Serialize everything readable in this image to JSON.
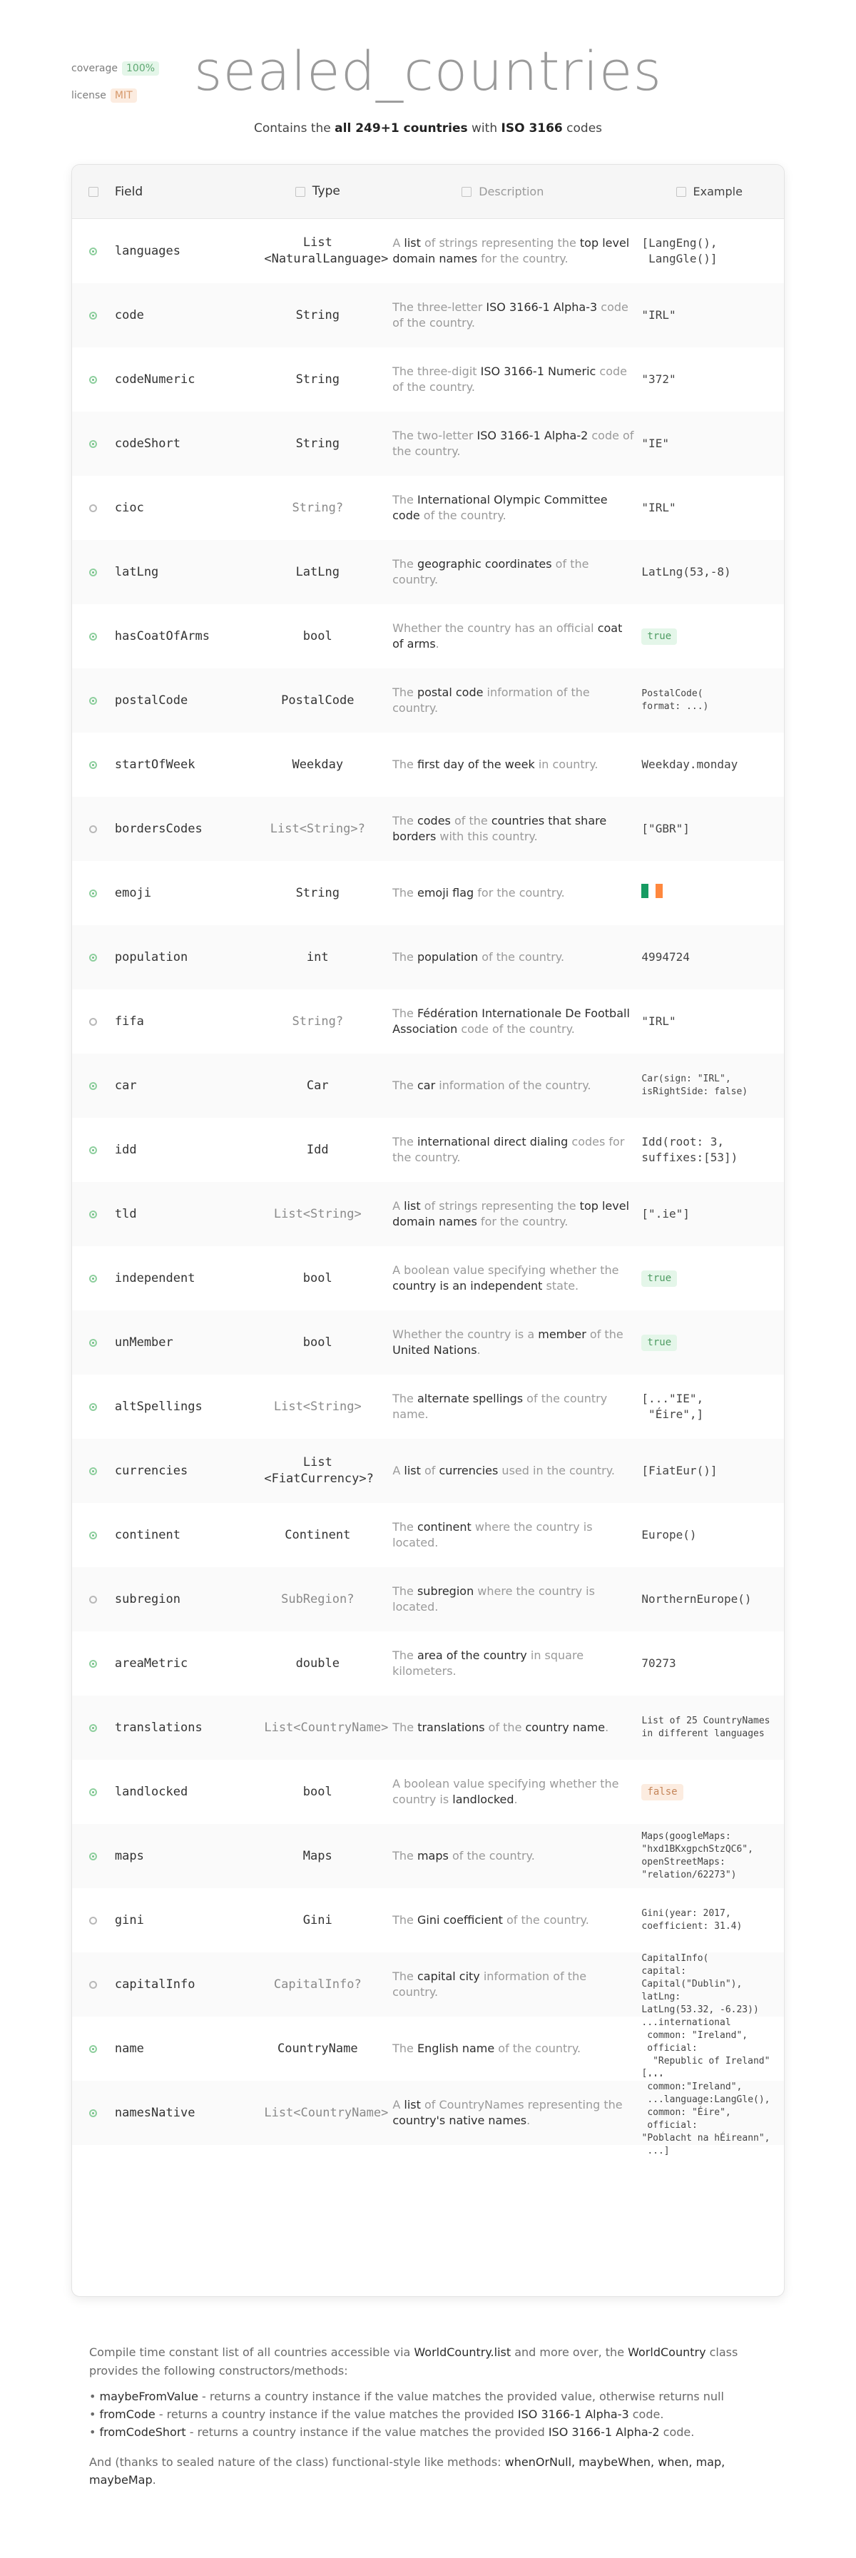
{
  "badges": [
    {
      "label": "coverage",
      "value": "100%"
    },
    {
      "label": "license",
      "value": "MIT"
    }
  ],
  "title": "sealed_countries",
  "subtitle": {
    "pre": "Contains the ",
    "bold1": "all 249+1 countries",
    "mid": " with ",
    "bold2": "ISO 3166",
    "post": " codes"
  },
  "table": {
    "headers": {
      "field": "Field",
      "type": "Type",
      "description": "Description",
      "example": "Example"
    },
    "rows": [
      {
        "field": "languages",
        "required": true,
        "type": [
          "List",
          "<NaturalLanguage>"
        ],
        "type_muted": false,
        "desc": [
          [
            "A ",
            false
          ],
          [
            "list",
            true
          ],
          [
            " of strings representing the ",
            false
          ],
          [
            "top level domain names",
            true
          ],
          [
            " for the country.",
            false
          ]
        ],
        "example": [
          "[LangEng(),",
          " LangGle()]"
        ],
        "ex_style": "mono"
      },
      {
        "field": "code",
        "required": true,
        "type": [
          "String"
        ],
        "type_muted": false,
        "desc": [
          [
            "The three-letter ",
            false
          ],
          [
            "ISO 3166-1 Alpha-3",
            true
          ],
          [
            " code of the country.",
            false
          ]
        ],
        "example": [
          "\"IRL\""
        ],
        "ex_style": "mono"
      },
      {
        "field": "codeNumeric",
        "required": true,
        "type": [
          "String"
        ],
        "type_muted": false,
        "desc": [
          [
            "The three-digit ",
            false
          ],
          [
            "ISO 3166-1 Numeric",
            true
          ],
          [
            " code of the country.",
            false
          ]
        ],
        "example": [
          "\"372\""
        ],
        "ex_style": "mono"
      },
      {
        "field": "codeShort",
        "required": true,
        "type": [
          "String"
        ],
        "type_muted": false,
        "desc": [
          [
            "The two-letter ",
            false
          ],
          [
            "ISO 3166-1 Alpha-2",
            true
          ],
          [
            " code of the country.",
            false
          ]
        ],
        "example": [
          "\"IE\""
        ],
        "ex_style": "mono"
      },
      {
        "field": "cioc",
        "required": false,
        "type": [
          "String?"
        ],
        "type_muted": true,
        "desc": [
          [
            "The ",
            false
          ],
          [
            "International Olympic Committee code",
            true
          ],
          [
            " of the country.",
            false
          ]
        ],
        "example": [
          "\"IRL\""
        ],
        "ex_style": "mono"
      },
      {
        "field": "latLng",
        "required": true,
        "type": [
          "LatLng"
        ],
        "type_muted": false,
        "desc": [
          [
            "The ",
            false
          ],
          [
            "geographic coordinates",
            true
          ],
          [
            " of the country.",
            false
          ]
        ],
        "example": [
          "LatLng(53,-8)"
        ],
        "ex_style": "mono"
      },
      {
        "field": "hasCoatOfArms",
        "required": true,
        "type": [
          "bool"
        ],
        "type_muted": false,
        "desc": [
          [
            "Whether the country has an official ",
            false
          ],
          [
            "coat of arms",
            true
          ],
          [
            ".",
            false
          ]
        ],
        "example": [
          "true"
        ],
        "ex_style": "pill-true"
      },
      {
        "field": "postalCode",
        "required": true,
        "type": [
          "PostalCode"
        ],
        "type_muted": false,
        "desc": [
          [
            "The ",
            false
          ],
          [
            "postal code",
            true
          ],
          [
            " information of the country.",
            false
          ]
        ],
        "example": [
          "PostalCode(",
          "format: ...)"
        ],
        "ex_style": "small"
      },
      {
        "field": "startOfWeek",
        "required": true,
        "type": [
          "Weekday"
        ],
        "type_muted": false,
        "desc": [
          [
            "The ",
            false
          ],
          [
            "first day of the week",
            true
          ],
          [
            " in country.",
            false
          ]
        ],
        "example": [
          "Weekday.monday"
        ],
        "ex_style": "mono"
      },
      {
        "field": "bordersCodes",
        "required": false,
        "type": [
          "List<String>?"
        ],
        "type_muted": true,
        "desc": [
          [
            "The ",
            false
          ],
          [
            "codes",
            true
          ],
          [
            " of the ",
            false
          ],
          [
            "countries that share borders",
            true
          ],
          [
            " with this country.",
            false
          ]
        ],
        "example": [
          "[\"GBR\"]"
        ],
        "ex_style": "mono"
      },
      {
        "field": "emoji",
        "required": true,
        "type": [
          "String"
        ],
        "type_muted": false,
        "desc": [
          [
            "The ",
            false
          ],
          [
            "emoji flag",
            true
          ],
          [
            " for the country.",
            false
          ]
        ],
        "example": [],
        "ex_style": "flag",
        "flag_colors": [
          "#169b62",
          "#ffffff",
          "#ff883e"
        ]
      },
      {
        "field": "population",
        "required": true,
        "type": [
          "int"
        ],
        "type_muted": false,
        "desc": [
          [
            "The ",
            false
          ],
          [
            "population",
            true
          ],
          [
            " of the country.",
            false
          ]
        ],
        "example": [
          "4994724"
        ],
        "ex_style": "mono"
      },
      {
        "field": "fifa",
        "required": false,
        "type": [
          "String?"
        ],
        "type_muted": true,
        "desc": [
          [
            "The ",
            false
          ],
          [
            "Fédération Internationale De Football Association",
            true
          ],
          [
            " code of the country.",
            false
          ]
        ],
        "example": [
          "\"IRL\""
        ],
        "ex_style": "mono"
      },
      {
        "field": "car",
        "required": true,
        "type": [
          "Car"
        ],
        "type_muted": false,
        "desc": [
          [
            "The ",
            false
          ],
          [
            "car",
            true
          ],
          [
            " information of the country.",
            false
          ]
        ],
        "example": [
          "Car(sign: \"IRL\",",
          "isRightSide: false)"
        ],
        "ex_style": "small"
      },
      {
        "field": "idd",
        "required": true,
        "type": [
          "Idd"
        ],
        "type_muted": false,
        "desc": [
          [
            "The ",
            false
          ],
          [
            "international direct dialing",
            true
          ],
          [
            " codes for the country.",
            false
          ]
        ],
        "example": [
          "Idd(root: 3,",
          "suffixes:[53])"
        ],
        "ex_style": "mono"
      },
      {
        "field": "tld",
        "required": true,
        "type": [
          "List<String>"
        ],
        "type_muted": true,
        "desc": [
          [
            "A ",
            false
          ],
          [
            "list",
            true
          ],
          [
            " of strings representing the ",
            false
          ],
          [
            "top level domain names",
            true
          ],
          [
            " for the country.",
            false
          ]
        ],
        "example": [
          "[\".ie\"]"
        ],
        "ex_style": "mono"
      },
      {
        "field": "independent",
        "required": true,
        "type": [
          "bool"
        ],
        "type_muted": false,
        "desc": [
          [
            "A boolean value specifying whether the ",
            false
          ],
          [
            "country is an independent",
            true
          ],
          [
            " state.",
            false
          ]
        ],
        "example": [
          "true"
        ],
        "ex_style": "pill-true"
      },
      {
        "field": "unMember",
        "required": true,
        "type": [
          "bool"
        ],
        "type_muted": false,
        "desc": [
          [
            "Whether the country is a ",
            false
          ],
          [
            "member",
            true
          ],
          [
            " of the ",
            false
          ],
          [
            "United Nations",
            true
          ],
          [
            ".",
            false
          ]
        ],
        "example": [
          "true"
        ],
        "ex_style": "pill-true"
      },
      {
        "field": "altSpellings",
        "required": true,
        "type": [
          "List<String>"
        ],
        "type_muted": true,
        "desc": [
          [
            "The ",
            false
          ],
          [
            "alternate spellings",
            true
          ],
          [
            " of the country name.",
            false
          ]
        ],
        "example": [
          "[...\"IE\",",
          " \"Éire\",]"
        ],
        "ex_style": "mono"
      },
      {
        "field": "currencies",
        "required": true,
        "type": [
          "List",
          "<FiatCurrency>?"
        ],
        "type_muted": false,
        "desc": [
          [
            "A ",
            false
          ],
          [
            "list",
            true
          ],
          [
            " of ",
            false
          ],
          [
            "currencies",
            true
          ],
          [
            " used in the country.",
            false
          ]
        ],
        "example": [
          "[FiatEur()]"
        ],
        "ex_style": "mono"
      },
      {
        "field": "continent",
        "required": true,
        "type": [
          "Continent"
        ],
        "type_muted": false,
        "desc": [
          [
            "The ",
            false
          ],
          [
            "continent",
            true
          ],
          [
            " where the country is located.",
            false
          ]
        ],
        "example": [
          "Europe()"
        ],
        "ex_style": "mono"
      },
      {
        "field": "subregion",
        "required": false,
        "type": [
          "SubRegion?"
        ],
        "type_muted": true,
        "desc": [
          [
            "The ",
            false
          ],
          [
            "subregion",
            true
          ],
          [
            " where the country is located.",
            false
          ]
        ],
        "example": [
          "NorthernEurope()"
        ],
        "ex_style": "mono"
      },
      {
        "field": "areaMetric",
        "required": true,
        "type": [
          "double"
        ],
        "type_muted": false,
        "desc": [
          [
            "The ",
            false
          ],
          [
            "area of the country",
            true
          ],
          [
            " in square kilometers.",
            false
          ]
        ],
        "example": [
          "70273"
        ],
        "ex_style": "mono"
      },
      {
        "field": "translations",
        "required": true,
        "type": [
          "List<CountryName>"
        ],
        "type_muted": true,
        "desc": [
          [
            "The ",
            false
          ],
          [
            "translations",
            true
          ],
          [
            " of the ",
            false
          ],
          [
            "country name",
            true
          ],
          [
            ".",
            false
          ]
        ],
        "example": [
          "List of 25 CountryNames",
          "in different languages"
        ],
        "ex_style": "small"
      },
      {
        "field": "landlocked",
        "required": true,
        "type": [
          "bool"
        ],
        "type_muted": false,
        "desc": [
          [
            "A boolean value specifying whether the country is ",
            false
          ],
          [
            "landlocked",
            true
          ],
          [
            ".",
            false
          ]
        ],
        "example": [
          "false"
        ],
        "ex_style": "pill-false"
      },
      {
        "field": "maps",
        "required": true,
        "type": [
          "Maps"
        ],
        "type_muted": false,
        "desc": [
          [
            "The ",
            false
          ],
          [
            "maps",
            true
          ],
          [
            " of the country.",
            false
          ]
        ],
        "example": [
          "Maps(googleMaps:",
          "\"hxd1BKxgpchStzQC6\",",
          "openStreetMaps:",
          "\"relation/62273\")"
        ],
        "ex_style": "small"
      },
      {
        "field": "gini",
        "required": false,
        "type": [
          "Gini"
        ],
        "type_muted": false,
        "desc": [
          [
            "The ",
            false
          ],
          [
            "Gini coefficient",
            true
          ],
          [
            " of the country.",
            false
          ]
        ],
        "example": [
          "Gini(year: 2017,",
          "coefficient: 31.4)"
        ],
        "ex_style": "small"
      },
      {
        "field": "capitalInfo",
        "required": false,
        "type": [
          "CapitalInfo?"
        ],
        "type_muted": true,
        "desc": [
          [
            "The ",
            false
          ],
          [
            "capital city",
            true
          ],
          [
            " information of the country.",
            false
          ]
        ],
        "example": [
          "CapitalInfo(",
          "capital:",
          "Capital(\"Dublin\"),",
          "latLng:",
          "LatLng(53.32, -6.23))"
        ],
        "ex_style": "small"
      },
      {
        "field": "name",
        "required": true,
        "type": [
          "CountryName"
        ],
        "type_muted": false,
        "desc": [
          [
            "The ",
            false
          ],
          [
            "English name",
            true
          ],
          [
            " of the country.",
            false
          ]
        ],
        "example": [
          "...international",
          " common: \"Ireland\",",
          " official:",
          "  \"Republic of Ireland\"",
          " ..."
        ],
        "ex_style": "small"
      },
      {
        "field": "namesNative",
        "required": true,
        "type": [
          "List<CountryName>"
        ],
        "type_muted": true,
        "desc": [
          [
            "A ",
            false
          ],
          [
            "list",
            true
          ],
          [
            " of CountryNames representing the ",
            false
          ],
          [
            "country's native names",
            true
          ],
          [
            ".",
            false
          ]
        ],
        "example": [
          "[...",
          " common:\"Ireland\",",
          " ...language:LangGle(),",
          " common: \"Éire\",",
          " official:",
          "\"Poblacht na hÉireann\",",
          " ...]"
        ],
        "ex_style": "small"
      }
    ]
  },
  "footer": {
    "intro": [
      [
        "Compile time constant list of all countries accessible via ",
        false
      ],
      [
        "WorldCountry.list",
        true
      ],
      [
        " and more over, the ",
        false
      ],
      [
        "WorldCountry",
        true
      ],
      [
        " class provides the following constructors/methods:",
        false
      ]
    ],
    "bullets": [
      [
        [
          "maybeFromValue",
          true
        ],
        [
          " - returns a country instance if the value matches the provided value, otherwise returns ",
          false
        ],
        [
          "null",
          false
        ]
      ],
      [
        [
          "fromCode",
          true
        ],
        [
          " - returns a country instance if the value matches the provided ",
          false
        ],
        [
          "ISO 3166-1 Alpha-3",
          true
        ],
        [
          " code.",
          false
        ]
      ],
      [
        [
          "fromCodeShort",
          true
        ],
        [
          " - returns a country instance if the value matches the provided ",
          false
        ],
        [
          "ISO 3166-1 Alpha-2",
          true
        ],
        [
          " code.",
          false
        ]
      ]
    ],
    "outro": [
      [
        "And (thanks to sealed nature of the class) functional-style like methods: ",
        false
      ],
      [
        "whenOrNull, maybeWhen, when, map, maybeMap",
        true
      ],
      [
        ".",
        false
      ]
    ]
  }
}
